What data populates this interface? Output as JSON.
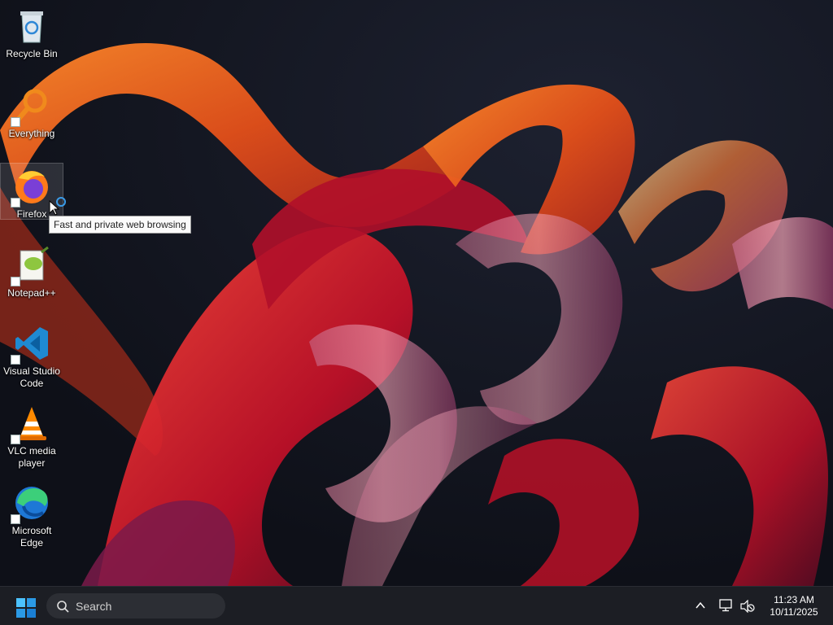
{
  "desktop": {
    "icons": [
      {
        "label": "Recycle Bin",
        "icon": "recycle-bin-icon"
      },
      {
        "label": "Everything",
        "icon": "everything-search-icon"
      },
      {
        "label": "Firefox",
        "icon": "firefox-icon"
      },
      {
        "label": "Notepad++",
        "icon": "notepad-plus-plus-icon"
      },
      {
        "label": "Visual Studio Code",
        "icon": "vscode-icon"
      },
      {
        "label": "VLC media player",
        "icon": "vlc-icon"
      },
      {
        "label": "Microsoft Edge",
        "icon": "edge-icon"
      }
    ],
    "tooltip": "Fast and private web browsing"
  },
  "taskbar": {
    "search_label": "Search",
    "clock_time": "11:23 AM",
    "clock_date": "10/11/2025"
  },
  "colors": {
    "taskbar_bg": "#1c1e24",
    "wallpaper_bg": "#141722",
    "accent_orange": "#e8611a",
    "accent_red": "#c8102e",
    "windows_blue": "#2b9ae6"
  }
}
